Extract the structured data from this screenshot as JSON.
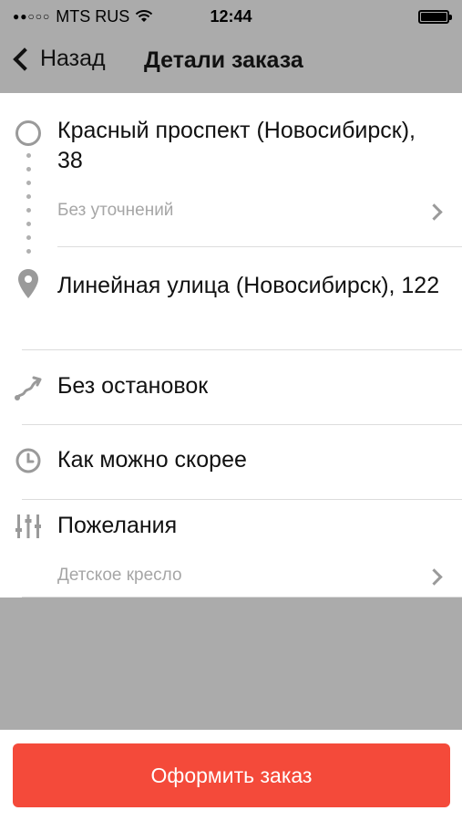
{
  "status_bar": {
    "carrier": "MTS RUS",
    "time": "12:44"
  },
  "nav": {
    "back_label": "Назад",
    "title": "Детали заказа"
  },
  "route": {
    "from_address": "Красный проспект (Новосибирск), 38",
    "from_note": "Без уточнений",
    "to_address": "Линейная улица (Новосибирск), 122"
  },
  "stops": {
    "label": "Без остановок"
  },
  "time": {
    "label": "Как можно скорее"
  },
  "wishes": {
    "label": "Пожелания",
    "value": "Детское кресло"
  },
  "footer": {
    "order_button": "Оформить заказ"
  },
  "colors": {
    "accent": "#f44a3a",
    "header_bg": "#ababab",
    "icon_gray": "#9a9a9a"
  }
}
